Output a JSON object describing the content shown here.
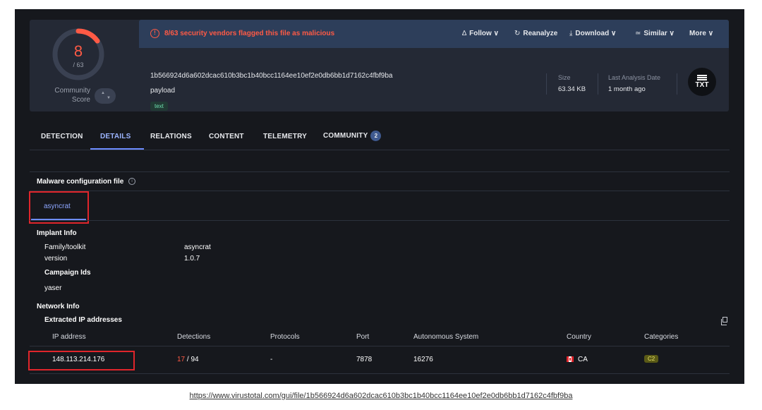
{
  "score": {
    "detections": "8",
    "total": "/ 63",
    "community_label": "Community\nScore"
  },
  "alert": {
    "text": "8/63 security vendors flagged this file as malicious",
    "icon": "!"
  },
  "actions": [
    {
      "icon": "bell-icon",
      "glyph": "∆",
      "label": "Follow",
      "chevron": "∨"
    },
    {
      "icon": "reload-icon",
      "glyph": "↻",
      "label": "Reanalyze",
      "chevron": ""
    },
    {
      "icon": "download-icon",
      "glyph": "⤓",
      "label": "Download",
      "chevron": "∨"
    },
    {
      "icon": "similar-icon",
      "glyph": "≃",
      "label": "Similar",
      "chevron": "∨"
    },
    {
      "icon": "more-icon",
      "glyph": "",
      "label": "More",
      "chevron": "∨"
    }
  ],
  "file": {
    "hash": "1b566924d6a602dcac610b3bc1b40bcc1164ee10ef2e0db6bb1d7162c4fbf9ba",
    "name": "payload",
    "tag": "text",
    "size_label": "Size",
    "size_value": "63.34 KB",
    "date_label": "Last Analysis Date",
    "date_value": "1 month ago",
    "type_icon": "TXT"
  },
  "tabs": [
    "DETECTION",
    "DETAILS",
    "RELATIONS",
    "CONTENT",
    "TELEMETRY",
    "COMMUNITY"
  ],
  "community_count": "2",
  "config": {
    "title": "Malware configuration file",
    "subtab": "asyncrat",
    "implant_title": "Implant Info",
    "family_label": "Family/toolkit",
    "family_value": "asyncrat",
    "version_label": "version",
    "version_value": "1.0.7",
    "campaign_title": "Campaign Ids",
    "campaign_value": "yaser",
    "network_title": "Network Info",
    "extracted_title": "Extracted IP addresses"
  },
  "table": {
    "headers": [
      "IP address",
      "Detections",
      "Protocols",
      "Port",
      "Autonomous System",
      "Country",
      "Categories"
    ],
    "row": {
      "ip": "148.113.214.176",
      "det_malicious": "17",
      "det_total": " / 94",
      "protocols": "-",
      "port": "7878",
      "as": "16276",
      "country": "CA",
      "category": "C2"
    }
  },
  "caption_url": "https://www.virustotal.com/gui/file/1b566924d6a602dcac610b3bc1b40bcc1164ee10ef2e0db6bb1d7162c4fbf9ba",
  "colors": {
    "bg": "#16181d",
    "card": "#242935",
    "alert_bar": "#2d3e5a",
    "malicious": "#ff5a45",
    "accent": "#6d8dff",
    "highlight_box": "#e0252b"
  }
}
